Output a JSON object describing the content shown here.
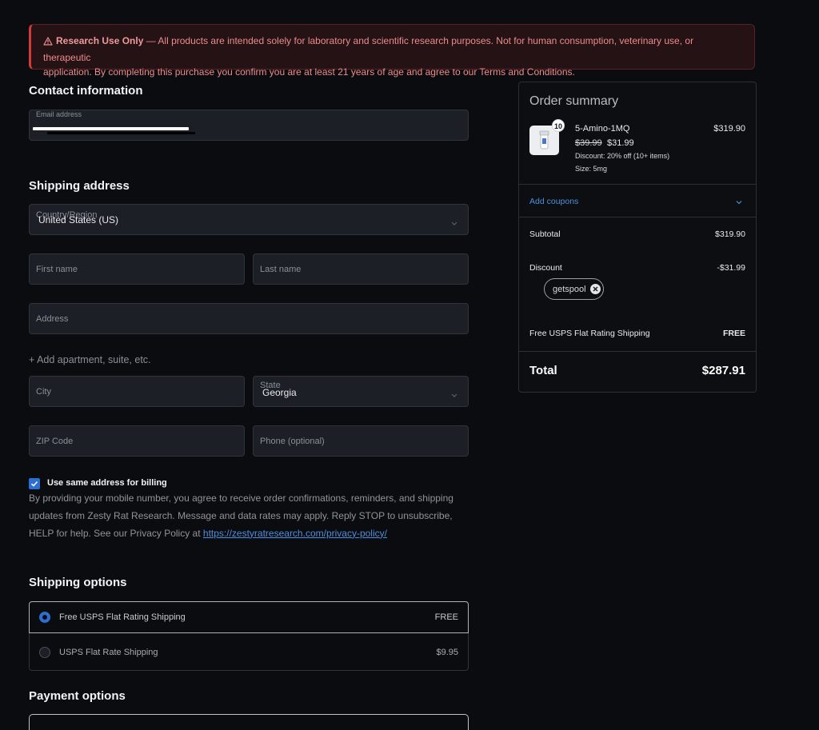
{
  "warning": {
    "title": "Research Use Only",
    "text_line1": " — All products are intended solely for laboratory and scientific research purposes. Not for human consumption, veterinary use, or therapeutic",
    "text_line2": "application. By completing this purchase you confirm you are at least 21 years of age and agree to our Terms and Conditions."
  },
  "contact": {
    "heading": "Contact information",
    "email_label": "Email address"
  },
  "shipping_address": {
    "heading": "Shipping address",
    "country_label": "Country/Region",
    "country_value": "United States (US)",
    "first_name_placeholder": "First name",
    "last_name_placeholder": "Last name",
    "address_placeholder": "Address",
    "add_apartment": "+ Add apartment, suite, etc.",
    "city_placeholder": "City",
    "state_label": "State",
    "state_value": "Georgia",
    "zip_placeholder": "ZIP Code",
    "phone_placeholder": "Phone (optional)"
  },
  "billing": {
    "same_address_label": "Use same address for billing",
    "checked": true,
    "consent_text": "By providing your mobile number, you agree to receive order confirmations, reminders, and shipping updates from Zesty Rat Research. Message and data rates may apply. Reply STOP to unsubscribe, HELP for help. See our Privacy Policy at ",
    "privacy_link": "https://zestyratresearch.com/privacy-policy/"
  },
  "shipping_options": {
    "heading": "Shipping options",
    "options": [
      {
        "name": "Free USPS Flat Rating Shipping",
        "price": "FREE",
        "selected": true
      },
      {
        "name": "USPS Flat Rate Shipping",
        "price": "$9.95",
        "selected": false
      }
    ]
  },
  "payment": {
    "heading": "Payment options"
  },
  "summary": {
    "title": "Order summary",
    "item": {
      "name": "5-Amino-1MQ",
      "quantity": "10",
      "line_total": "$319.90",
      "original_price": "$39.99",
      "sale_price": "$31.99",
      "discount_note": "Discount: 20% off (10+ items)",
      "size": "Size: 5mg"
    },
    "add_coupons": "Add coupons",
    "subtotal_label": "Subtotal",
    "subtotal_value": "$319.90",
    "discount_label": "Discount",
    "discount_value": "-$31.99",
    "coupon_code": "getspool",
    "shipping_label": "Free USPS Flat Rating Shipping",
    "shipping_value": "FREE",
    "total_label": "Total",
    "total_value": "$287.91"
  },
  "colors": {
    "background": "#0b0c0f",
    "accent_blue": "#2b6fd1",
    "warning_red": "#d23a3a",
    "link_blue": "#4f8fe0"
  }
}
